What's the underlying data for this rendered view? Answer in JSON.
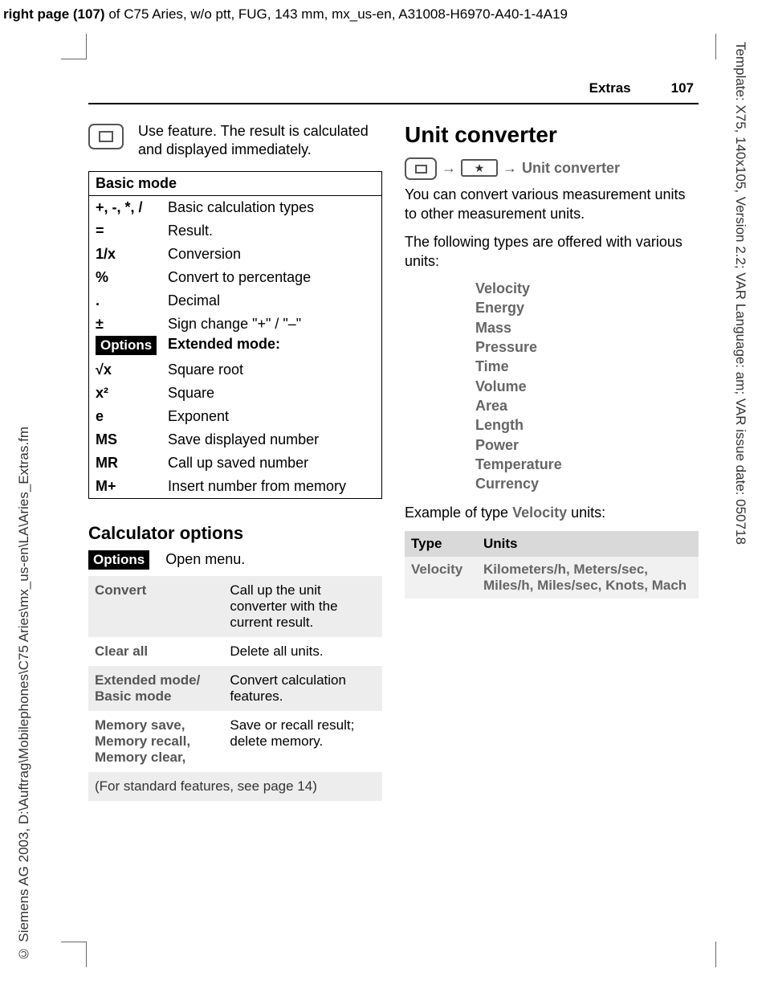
{
  "meta": {
    "headerPrefix": "right page (107)",
    "headerRest": " of C75 Aries, w/o ptt, FUG, 143 mm, mx_us-en, A31008-H6970-A40-1-4A19",
    "leftSide": "© Siemens AG 2003, D:\\Auftrag\\Mobilephones\\C75 Aries\\mx_us-en\\LA\\Aries_Extras.fm",
    "rightSide": "Template: X75, 140x105, Version 2.2; VAR Language: am; VAR issue date: 050718"
  },
  "page": {
    "section": "Extras",
    "number": "107"
  },
  "leftCol": {
    "intro": "Use feature. The result is calculated and displayed immediately.",
    "basicTitle": "Basic mode",
    "rows": [
      {
        "k": "+, -, *, /",
        "v": "Basic calculation types"
      },
      {
        "k": "=",
        "v": "Result."
      },
      {
        "k": "1/x",
        "v": "Conversion"
      },
      {
        "k": "%",
        "v": "Convert to percentage"
      },
      {
        "k": ".",
        "v": "Decimal"
      },
      {
        "k": "±",
        "v": "Sign change \"+\" / \"–\""
      }
    ],
    "optionsChip": "Options",
    "extTitle": "Extended mode:",
    "extRows": [
      {
        "k": "√x",
        "v": "Square root"
      },
      {
        "k": "x²",
        "v": "Square"
      },
      {
        "k": "e",
        "v": "Exponent"
      },
      {
        "k": "MS",
        "v": "Save displayed number"
      },
      {
        "k": "MR",
        "v": "Call up saved number"
      },
      {
        "k": "M+",
        "v": "Insert number from memory"
      }
    ],
    "calcOptions": {
      "title": "Calculator options",
      "optionsChip": "Options",
      "openMenu": "Open menu.",
      "rows": [
        {
          "lbl": "Convert",
          "desc": "Call up the unit converter with the current result."
        },
        {
          "lbl": "Clear all",
          "desc": "Delete all units."
        },
        {
          "lbl": "Extended mode/ Basic mode",
          "desc": "Convert calculation features."
        },
        {
          "lbl": "Memory save, Memory recall, Memory clear,",
          "desc": "Save or recall result; delete memory."
        }
      ],
      "footer": "(For standard features, see page 14)"
    }
  },
  "rightCol": {
    "title": "Unit converter",
    "navLabel": "Unit converter",
    "intro1": "You can convert various measurement units to other measurement units.",
    "intro2": "The following types are offered with various units:",
    "types": [
      "Velocity",
      "Energy",
      "Mass",
      "Pressure",
      "Time",
      "Volume",
      "Area",
      "Length",
      "Power",
      "Temperature",
      "Currency"
    ],
    "exampleLabelPre": "Example of type ",
    "exampleType": "Velocity",
    "exampleLabelPost": " units:",
    "exTable": {
      "h1": "Type",
      "h2": "Units",
      "r1c1": "Velocity",
      "r1c2": "Kilometers/h, Meters/sec, Miles/h, Miles/sec, Knots, Mach"
    }
  }
}
